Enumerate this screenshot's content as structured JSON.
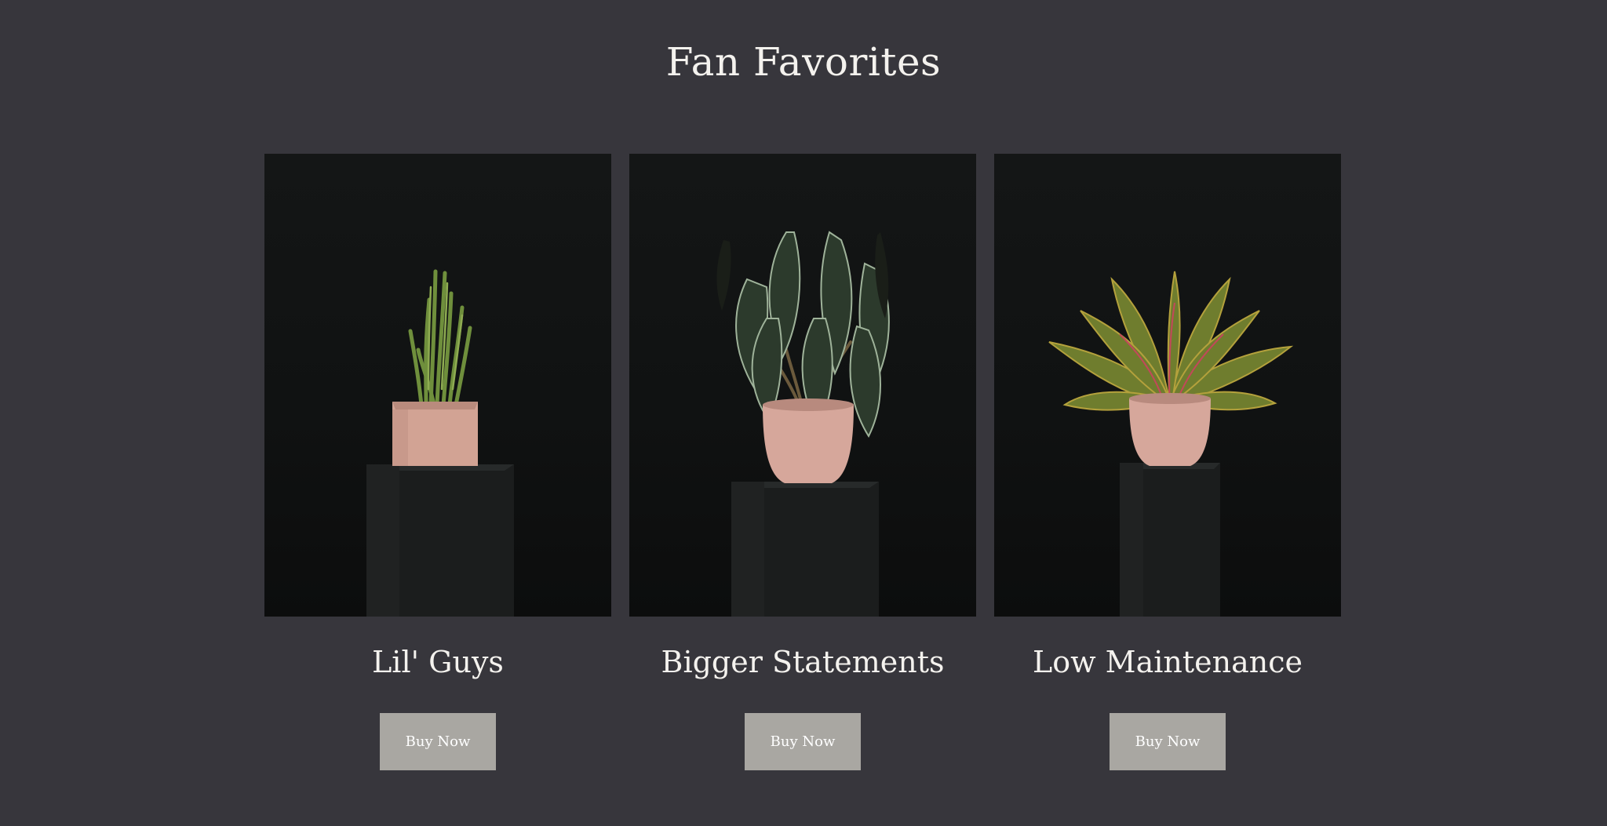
{
  "section": {
    "title": "Fan Favorites"
  },
  "cards": [
    {
      "title": "Lil' Guys",
      "button_label": "Buy Now",
      "image": "snake-plant-in-square-pink-pot-on-pedestal"
    },
    {
      "title": "Bigger Statements",
      "button_label": "Buy Now",
      "image": "alocasia-in-round-pink-pot-on-pedestal"
    },
    {
      "title": "Low Maintenance",
      "button_label": "Buy Now",
      "image": "aglaonema-in-round-pink-pot-on-pedestal"
    }
  ],
  "colors": {
    "background": "#37363c",
    "text": "#f4f2ee",
    "button": "#a9a7a2",
    "pot": "#d6a79b"
  }
}
